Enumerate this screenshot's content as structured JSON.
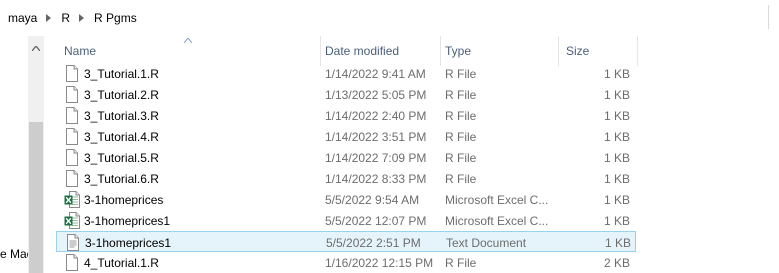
{
  "breadcrumb": {
    "items": [
      "maya",
      "R",
      "R Pgms"
    ]
  },
  "nav": {
    "clipped_text": "e Mac"
  },
  "columns": {
    "name": "Name",
    "date": "Date modified",
    "type": "Type",
    "size": "Size"
  },
  "files": [
    {
      "name": "3_Tutorial.1.R",
      "date": "1/14/2022 9:41 AM",
      "type": "R File",
      "size": "1 KB",
      "icon": "document-icon"
    },
    {
      "name": "3_Tutorial.2.R",
      "date": "1/13/2022 5:05 PM",
      "type": "R File",
      "size": "1 KB",
      "icon": "document-icon"
    },
    {
      "name": "3_Tutorial.3.R",
      "date": "1/14/2022 2:40 PM",
      "type": "R File",
      "size": "1 KB",
      "icon": "document-icon"
    },
    {
      "name": "3_Tutorial.4.R",
      "date": "1/14/2022 3:51 PM",
      "type": "R File",
      "size": "1 KB",
      "icon": "document-icon"
    },
    {
      "name": "3_Tutorial.5.R",
      "date": "1/14/2022 7:09 PM",
      "type": "R File",
      "size": "1 KB",
      "icon": "document-icon"
    },
    {
      "name": "3_Tutorial.6.R",
      "date": "1/14/2022 8:33 PM",
      "type": "R File",
      "size": "1 KB",
      "icon": "document-icon"
    },
    {
      "name": "3-1homeprices",
      "date": "5/5/2022 9:54 AM",
      "type": "Microsoft Excel C...",
      "size": "1 KB",
      "icon": "excel-csv-icon"
    },
    {
      "name": "3-1homeprices1",
      "date": "5/5/2022 12:07 PM",
      "type": "Microsoft Excel C...",
      "size": "1 KB",
      "icon": "excel-csv-icon"
    },
    {
      "name": "3-1homeprices1",
      "date": "5/5/2022 2:51 PM",
      "type": "Text Document",
      "size": "1 KB",
      "icon": "text-document-icon",
      "selected": true
    },
    {
      "name": "4_Tutorial.1.R",
      "date": "1/16/2022 12:15 PM",
      "type": "R File",
      "size": "2 KB",
      "icon": "document-icon"
    }
  ],
  "colors": {
    "selected_bg": "#e5f3fb",
    "selected_border": "#99d1ef",
    "header_text": "#4c607a",
    "excel_green": "#1e7145"
  }
}
